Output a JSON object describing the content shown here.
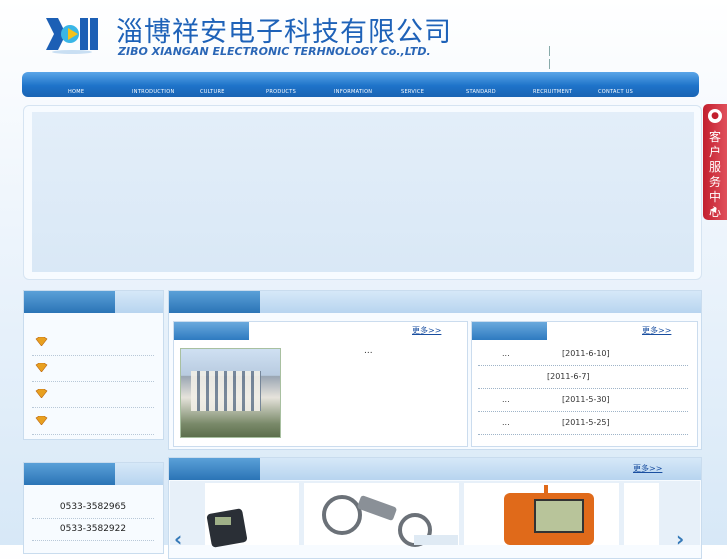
{
  "header": {
    "company_cn": "淄博祥安电子科技有限公司",
    "company_en": "ZIBO XIANGAN ELECTRONIC TERHNOLOGY Co.,LTD.",
    "logo_icon": "company-logo-icon"
  },
  "nav": {
    "items": [
      "HOME",
      "INTRODUCTION",
      "CULTURE",
      "PRODUCTS",
      "INFORMATION",
      "SERVICE",
      "STANDARD",
      "RECRUITMENT",
      "CONTACT US"
    ]
  },
  "service_tab": {
    "label": "客户服务中心",
    "icon": "qq-penguin-icon",
    "arrow": "◀"
  },
  "left_list": {
    "items": [
      "",
      "",
      "",
      ""
    ],
    "icon": "diamond-bullet-icon"
  },
  "contact": {
    "phones": [
      "0533-3582965",
      "0533-3582922"
    ]
  },
  "intro": {
    "more": "更多>>",
    "text": "..."
  },
  "news": {
    "more": "更多>>",
    "rows": [
      {
        "prefix": "...",
        "date": "[2011-6-10]"
      },
      {
        "prefix": "",
        "date": "[2011-6-7]"
      },
      {
        "prefix": "...",
        "date": "[2011-5-30]"
      },
      {
        "prefix": "...",
        "date": "[2011-5-25]"
      }
    ]
  },
  "products": {
    "more": "更多>>",
    "prev": "‹",
    "next": "›"
  },
  "colors": {
    "brand_blue": "#1e62b8",
    "nav_blue": "#1e73c9",
    "service_red": "#c21f2e"
  }
}
